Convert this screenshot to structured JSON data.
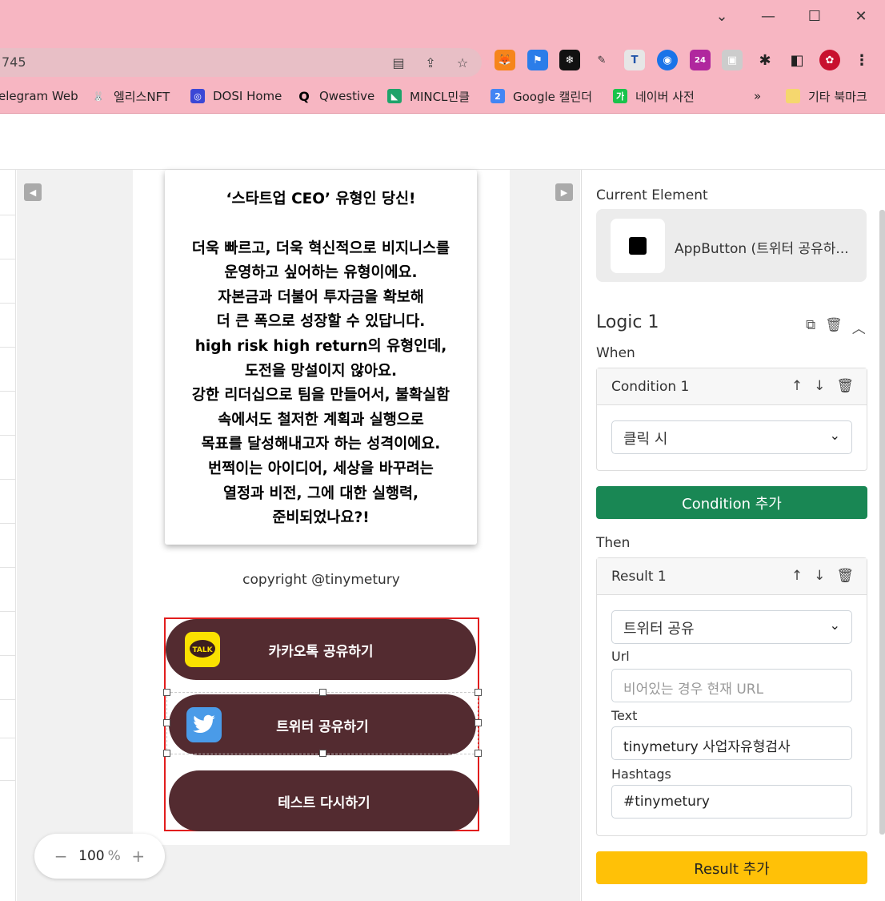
{
  "browser": {
    "url_text": "745",
    "window_controls": [
      "⌄",
      "—",
      "☐",
      "✕"
    ],
    "ext_badge": "24",
    "bookmarks": [
      {
        "label": "elegram Web"
      },
      {
        "label": "엘리스NFT"
      },
      {
        "label": "DOSI Home"
      },
      {
        "label": "Qwestive"
      },
      {
        "label": "MINCL민클"
      },
      {
        "label": "Google 캘린더"
      },
      {
        "label": "네이버 사전"
      },
      {
        "label": "기타 북마크"
      }
    ],
    "bookmarks_more": "»"
  },
  "canvas": {
    "result_lines": [
      "‘스타트업 CEO’ 유형인 당신!",
      "",
      "더욱 빠르고, 더욱 혁신적으로 비지니스를",
      "운영하고 싶어하는 유형이에요.",
      "자본금과 더불어 투자금을 확보해",
      "더 큰 폭으로 성장할 수 있답니다.",
      "high risk high return의 유형인데,",
      "도전을 망설이지 않아요.",
      "강한 리더십으로 팀을 만들어서, 불확실함",
      "속에서도 철저한 계획과 실행으로",
      "목표를 달성해내고자 하는 성격이에요.",
      "번쩍이는 아이디어, 세상을 바꾸려는",
      "열정과 비전, 그에 대한 실행력,",
      "준비되었나요?!"
    ],
    "copyright": "copyright @tinymetury",
    "buttons": {
      "kakao": "카카오톡 공유하기",
      "kakao_icon_text": "TALK",
      "twitter": "트위터 공유하기",
      "retry": "테스트 다시하기"
    },
    "zoom": {
      "minus": "−",
      "value": "100",
      "unit": "%",
      "plus": "+"
    }
  },
  "panel": {
    "current_element_label": "Current Element",
    "current_element_name": "AppButton (트위터 공유하...",
    "logic_title": "Logic 1",
    "when_label": "When",
    "condition_title": "Condition 1",
    "condition_select": "클릭 시",
    "add_condition": "Condition 추가",
    "then_label": "Then",
    "result_title": "Result 1",
    "result_select": "트위터 공유",
    "url_label": "Url",
    "url_placeholder": "비어있는 경우 현재 URL",
    "text_label": "Text",
    "text_value": "tinymetury 사업자유형검사",
    "hashtags_label": "Hashtags",
    "hashtags_value": "#tinymetury",
    "add_result": "Result 추가"
  },
  "colors": {
    "chrome_pink": "#f7b6c2",
    "button_brown": "#532b30",
    "green": "#198754",
    "yellow": "#ffc107",
    "selection_red": "#e21d1d"
  }
}
